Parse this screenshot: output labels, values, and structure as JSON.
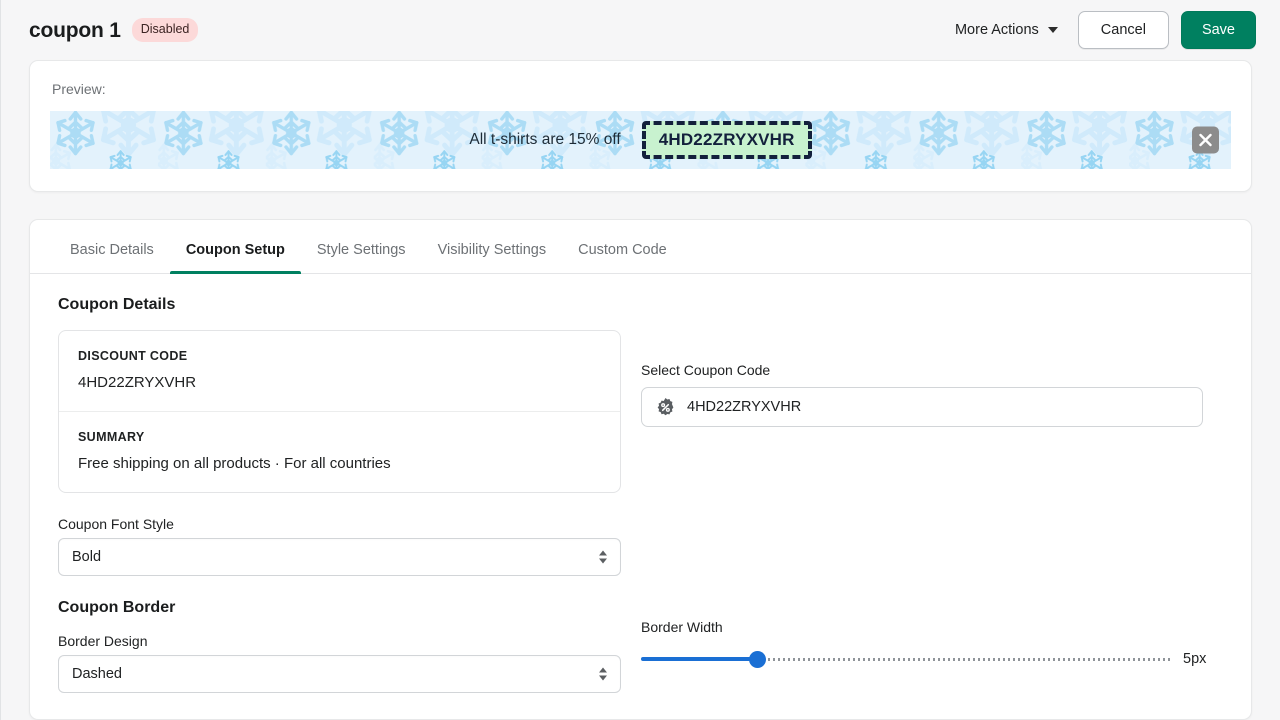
{
  "header": {
    "title": "coupon 1",
    "status_badge": "Disabled",
    "more_actions_label": "More Actions",
    "cancel_label": "Cancel",
    "save_label": "Save",
    "accent_green": "#008060",
    "badge_bg": "#fcd9d9"
  },
  "preview": {
    "label": "Preview:",
    "banner_text": "All t-shirts are 15% off",
    "coupon_code": "4HD22ZRYXVHR",
    "banner_bg": "#e3f2fc",
    "chip_bg": "#c8f2cf",
    "chip_border_color": "#13203c",
    "close_icon": "close-icon"
  },
  "tabs": [
    {
      "label": "Basic Details",
      "active": false
    },
    {
      "label": "Coupon Setup",
      "active": true
    },
    {
      "label": "Style Settings",
      "active": false
    },
    {
      "label": "Visibility Settings",
      "active": false
    },
    {
      "label": "Custom Code",
      "active": false
    }
  ],
  "coupon_details": {
    "section_title": "Coupon Details",
    "rows": [
      {
        "key": "DISCOUNT CODE",
        "value": "4HD22ZRYXVHR"
      },
      {
        "key": "SUMMARY",
        "value": "Free shipping on all products · For all countries"
      }
    ]
  },
  "font_style": {
    "label": "Coupon Font Style",
    "value": "Bold"
  },
  "coupon_border": {
    "section_title": "Coupon Border",
    "design_label": "Border Design",
    "design_value": "Dashed"
  },
  "select_coupon": {
    "label": "Select Coupon Code",
    "value": "4HD22ZRYXVHR",
    "icon": "discount-percent-badge-icon"
  },
  "border_width": {
    "label": "Border Width",
    "value": "5px",
    "track_color": "#1a6fd4"
  }
}
